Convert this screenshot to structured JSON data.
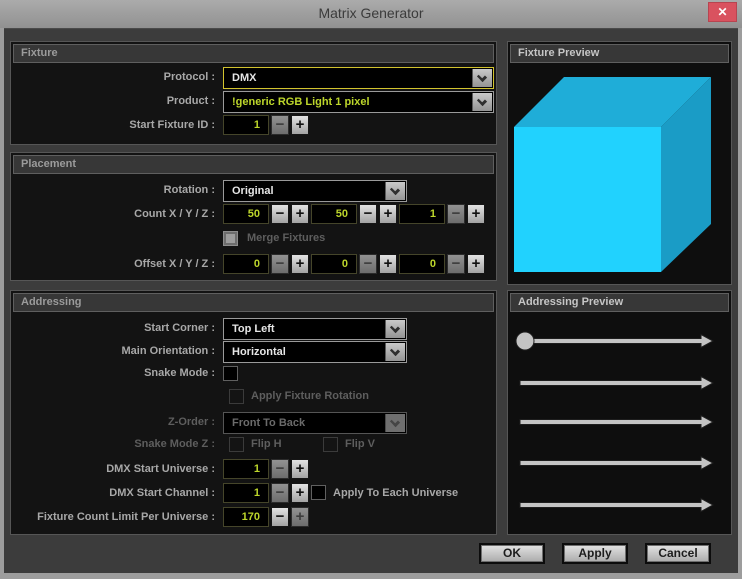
{
  "window": {
    "title": "Matrix Generator"
  },
  "icons": {
    "close": "✕",
    "minus": "−",
    "plus": "+",
    "chevron": "chevron-down"
  },
  "colors": {
    "cube_front": "#21d2fe",
    "cube_top": "#1fadd8",
    "cube_right": "#1a9cc6",
    "arrow": "#c4c4c4",
    "value_yellow": "#bdd62b",
    "close_red": "#d9525f",
    "focus_border": "#d2c32e"
  },
  "fixture": {
    "header": "Fixture",
    "protocol_label": "Protocol :",
    "protocol_value": "DMX",
    "product_label": "Product :",
    "product_value": "!generic RGB Light 1 pixel",
    "start_fixture_id_label": "Start Fixture ID :",
    "start_fixture_id_value": "1"
  },
  "placement": {
    "header": "Placement",
    "rotation_label": "Rotation :",
    "rotation_value": "Original",
    "count_label": "Count X / Y / Z :",
    "count_x": "50",
    "count_y": "50",
    "count_z": "1",
    "merge_fixtures_label": "Merge Fixtures",
    "offset_label": "Offset X / Y / Z :",
    "offset_x": "0",
    "offset_y": "0",
    "offset_z": "0"
  },
  "addressing": {
    "header": "Addressing",
    "start_corner_label": "Start Corner :",
    "start_corner_value": "Top Left",
    "main_orientation_label": "Main Orientation :",
    "main_orientation_value": "Horizontal",
    "snake_mode_label": "Snake Mode :",
    "apply_fixture_rotation_label": "Apply Fixture Rotation",
    "z_order_label": "Z-Order :",
    "z_order_value": "Front To Back",
    "snake_mode_z_label": "Snake Mode Z :",
    "flip_h_label": "Flip H",
    "flip_v_label": "Flip V",
    "dmx_start_universe_label": "DMX Start Universe :",
    "dmx_start_universe_value": "1",
    "dmx_start_channel_label": "DMX Start Channel :",
    "dmx_start_channel_value": "1",
    "apply_to_each_universe_label": "Apply To Each Universe",
    "fixture_count_limit_label": "Fixture Count Limit Per Universe :",
    "fixture_count_limit_value": "170"
  },
  "fixture_preview": {
    "header": "Fixture Preview"
  },
  "addressing_preview": {
    "header": "Addressing Preview",
    "arrow_count": 5,
    "direction": "left-to-right"
  },
  "footer": {
    "ok": "OK",
    "apply": "Apply",
    "cancel": "Cancel"
  }
}
